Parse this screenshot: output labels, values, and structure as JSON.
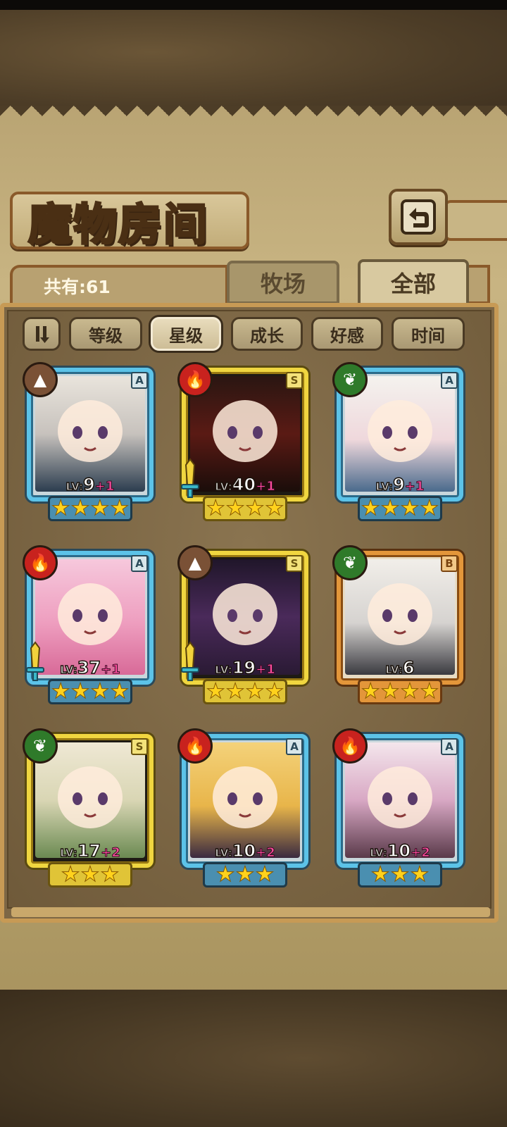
{
  "header": {
    "title": "魔物房间",
    "back_icon": "back-arrow-icon"
  },
  "summary": {
    "total_label": "共有:61"
  },
  "tabs": [
    {
      "label": "牧场",
      "selected": false
    },
    {
      "label": "全部",
      "selected": true
    }
  ],
  "sort": {
    "toggle_icon": "sort-order-icon",
    "buttons": [
      {
        "label": "等级",
        "selected": false
      },
      {
        "label": "星级",
        "selected": true
      },
      {
        "label": "成长",
        "selected": false
      },
      {
        "label": "好感",
        "selected": false
      },
      {
        "label": "时间",
        "selected": false
      }
    ]
  },
  "monsters": [
    {
      "element": "earth",
      "rank": "A",
      "frame": "blue",
      "level": "9",
      "bonus": "+1",
      "stars": 4,
      "weapon": false
    },
    {
      "element": "fire",
      "rank": "S",
      "frame": "gold",
      "level": "40",
      "bonus": "+1",
      "stars": 4,
      "weapon": true
    },
    {
      "element": "wood",
      "rank": "A",
      "frame": "blue",
      "level": "9",
      "bonus": "+1",
      "stars": 4,
      "weapon": false
    },
    {
      "element": "fire",
      "rank": "A",
      "frame": "blue",
      "level": "37",
      "bonus": "+1",
      "stars": 4,
      "weapon": true
    },
    {
      "element": "earth",
      "rank": "S",
      "frame": "gold",
      "level": "19",
      "bonus": "+1",
      "stars": 4,
      "weapon": true
    },
    {
      "element": "wood",
      "rank": "B",
      "frame": "orange",
      "level": "6",
      "bonus": "",
      "stars": 4,
      "weapon": false
    },
    {
      "element": "wood",
      "rank": "S",
      "frame": "gold",
      "level": "17",
      "bonus": "+2",
      "stars": 3,
      "weapon": false
    },
    {
      "element": "fire",
      "rank": "A",
      "frame": "blue",
      "level": "10",
      "bonus": "+2",
      "stars": 3,
      "weapon": false
    },
    {
      "element": "fire",
      "rank": "A",
      "frame": "blue",
      "level": "10",
      "bonus": "+2",
      "stars": 3,
      "weapon": false
    }
  ],
  "level_prefix": "LV:",
  "colors": {
    "parchment": "#c8b482",
    "frame_blue": "#5cc3e8",
    "frame_gold": "#f0d640",
    "frame_orange": "#e3963a",
    "fire": "#c8221e",
    "wood": "#2f7a2a",
    "earth": "#7a5136",
    "star": "#ffd21c",
    "bonus": "#ff4fa0"
  }
}
